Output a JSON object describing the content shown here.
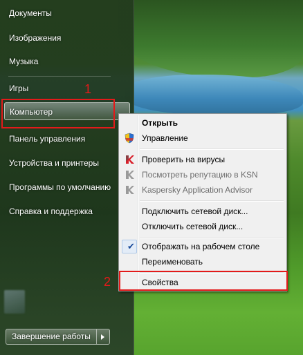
{
  "start_menu": {
    "items": [
      {
        "label": "Документы"
      },
      {
        "label": "Изображения"
      },
      {
        "label": "Музыка"
      },
      {
        "label": "Игры"
      },
      {
        "label": "Компьютер"
      },
      {
        "label": "Панель управления"
      },
      {
        "label": "Устройства и принтеры"
      },
      {
        "label": "Программы по умолчанию"
      },
      {
        "label": "Справка и поддержка"
      }
    ],
    "shutdown_label": "Завершение работы"
  },
  "context_menu": {
    "items": [
      {
        "label": "Открыть",
        "bold": true
      },
      {
        "label": "Управление",
        "icon": "shield-icon"
      },
      {
        "label": "Проверить на вирусы",
        "icon": "kaspersky-icon"
      },
      {
        "label": "Посмотреть репутацию в KSN",
        "icon": "kaspersky-icon",
        "disabled": true
      },
      {
        "label": "Kaspersky Application Advisor",
        "icon": "kaspersky-icon",
        "disabled": true
      },
      {
        "label": "Подключить сетевой диск..."
      },
      {
        "label": "Отключить сетевой диск..."
      },
      {
        "label": "Отображать на рабочем столе",
        "checked": true
      },
      {
        "label": "Переименовать"
      },
      {
        "label": "Свойства"
      }
    ]
  },
  "annotations": {
    "marker_1": "1",
    "marker_2": "2",
    "color": "#e31a1a"
  },
  "colors": {
    "menu_bg": "#f0f0f0",
    "disabled_text": "#6d6d6d",
    "accent_red": "#e31a1a"
  }
}
